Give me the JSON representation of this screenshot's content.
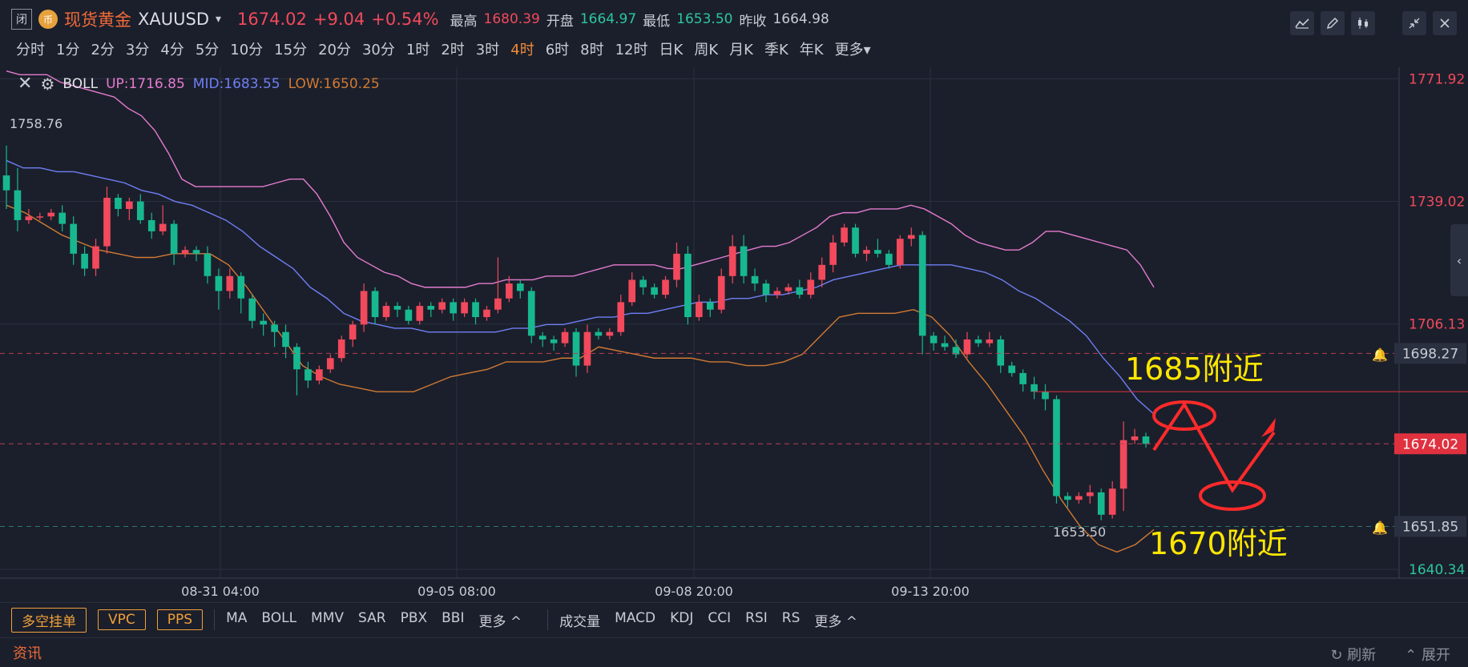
{
  "header": {
    "close_label": "闭",
    "coin_label": "币",
    "title": "现货黄金",
    "symbol": "XAUUSD",
    "dropdown_caret": "▾",
    "last_price": "1674.02",
    "change": "+9.04",
    "change_pct": "+0.54%",
    "high_label": "最高",
    "high_value": "1680.39",
    "open_label": "开盘",
    "open_value": "1664.97",
    "low_label": "最低",
    "low_value": "1653.50",
    "prev_close_label": "昨收",
    "prev_close_value": "1664.98"
  },
  "periods": [
    {
      "label": "分时",
      "active": false
    },
    {
      "label": "1分",
      "active": false
    },
    {
      "label": "2分",
      "active": false
    },
    {
      "label": "3分",
      "active": false
    },
    {
      "label": "4分",
      "active": false
    },
    {
      "label": "5分",
      "active": false
    },
    {
      "label": "10分",
      "active": false
    },
    {
      "label": "15分",
      "active": false
    },
    {
      "label": "20分",
      "active": false
    },
    {
      "label": "30分",
      "active": false
    },
    {
      "label": "1时",
      "active": false
    },
    {
      "label": "2时",
      "active": false
    },
    {
      "label": "3时",
      "active": false
    },
    {
      "label": "4时",
      "active": true
    },
    {
      "label": "6时",
      "active": false
    },
    {
      "label": "8时",
      "active": false
    },
    {
      "label": "12时",
      "active": false
    },
    {
      "label": "日K",
      "active": false
    },
    {
      "label": "周K",
      "active": false
    },
    {
      "label": "月K",
      "active": false
    },
    {
      "label": "季K",
      "active": false
    },
    {
      "label": "年K",
      "active": false
    },
    {
      "label": "更多▾",
      "active": false
    }
  ],
  "toolbar": {
    "icons": [
      "line-chart-icon",
      "pencil-icon",
      "candlestick-icon",
      "collapse-icon",
      "close-icon"
    ]
  },
  "boll": {
    "name": "BOLL",
    "up": "UP:1716.85",
    "mid": "MID:1683.55",
    "low": "LOW:1650.25",
    "colors": {
      "up": "#e57bd0",
      "mid": "#6f7ff5",
      "low": "#d17a33"
    }
  },
  "chart_data": {
    "type": "candlestick",
    "y_axis_ticks": [
      "1771.92",
      "1739.02",
      "1706.13",
      "1640.34"
    ],
    "price_tags": [
      "1698.27",
      "1674.02",
      "1651.85"
    ],
    "x_axis_ticks": [
      "08-31 04:00",
      "09-05 08:00",
      "09-08 20:00",
      "09-13 20:00"
    ],
    "ylim": [
      1638,
      1775
    ],
    "high_marker": "1758.76",
    "low_marker": "1653.50",
    "candles": [
      [
        1746,
        1742,
        1754,
        1737
      ],
      [
        1742,
        1734,
        1748,
        1731
      ],
      [
        1734,
        1735,
        1737,
        1733
      ],
      [
        1735,
        1735,
        1736,
        1734
      ],
      [
        1735,
        1736,
        1737,
        1734
      ],
      [
        1736,
        1733,
        1738,
        1731
      ],
      [
        1733,
        1725,
        1735,
        1722
      ],
      [
        1725,
        1721,
        1727,
        1719
      ],
      [
        1721,
        1727,
        1729,
        1719
      ],
      [
        1727,
        1740,
        1743,
        1725
      ],
      [
        1740,
        1737,
        1741,
        1735
      ],
      [
        1737,
        1739,
        1740,
        1734
      ],
      [
        1739,
        1734,
        1741,
        1733
      ],
      [
        1734,
        1731,
        1736,
        1729
      ],
      [
        1731,
        1733,
        1738,
        1730
      ],
      [
        1733,
        1725,
        1734,
        1722
      ],
      [
        1725,
        1726,
        1727,
        1724
      ],
      [
        1726,
        1725,
        1727,
        1723
      ],
      [
        1725,
        1719,
        1727,
        1717
      ],
      [
        1719,
        1715,
        1721,
        1710
      ],
      [
        1715,
        1719,
        1721,
        1713
      ],
      [
        1719,
        1713,
        1720,
        1709
      ],
      [
        1713,
        1707,
        1714,
        1705
      ],
      [
        1707,
        1706,
        1709,
        1703
      ],
      [
        1706,
        1704,
        1707,
        1700
      ],
      [
        1704,
        1700,
        1706,
        1697
      ],
      [
        1700,
        1694,
        1701,
        1687
      ],
      [
        1694,
        1691,
        1696,
        1689
      ],
      [
        1691,
        1694,
        1695,
        1690
      ],
      [
        1694,
        1697,
        1698,
        1693
      ],
      [
        1697,
        1702,
        1703,
        1696
      ],
      [
        1702,
        1706,
        1707,
        1700
      ],
      [
        1706,
        1715,
        1717,
        1704
      ],
      [
        1715,
        1708,
        1716,
        1706
      ],
      [
        1708,
        1711,
        1712,
        1707
      ],
      [
        1711,
        1710,
        1712,
        1708
      ],
      [
        1710,
        1707,
        1711,
        1706
      ],
      [
        1707,
        1711,
        1712,
        1706
      ],
      [
        1711,
        1710,
        1712,
        1708
      ],
      [
        1710,
        1712,
        1713,
        1709
      ],
      [
        1712,
        1709,
        1713,
        1707
      ],
      [
        1709,
        1712,
        1713,
        1708
      ],
      [
        1712,
        1708,
        1713,
        1706
      ],
      [
        1708,
        1710,
        1711,
        1707
      ],
      [
        1710,
        1713,
        1724,
        1709
      ],
      [
        1713,
        1717,
        1719,
        1712
      ],
      [
        1717,
        1715,
        1718,
        1713
      ],
      [
        1715,
        1703,
        1716,
        1701
      ],
      [
        1703,
        1702,
        1704,
        1700
      ],
      [
        1702,
        1701,
        1703,
        1699
      ],
      [
        1701,
        1704,
        1705,
        1700
      ],
      [
        1704,
        1695,
        1705,
        1692
      ],
      [
        1695,
        1704,
        1706,
        1693
      ],
      [
        1704,
        1703,
        1705,
        1702
      ],
      [
        1703,
        1704,
        1705,
        1702
      ],
      [
        1704,
        1712,
        1714,
        1703
      ],
      [
        1712,
        1718,
        1720,
        1711
      ],
      [
        1718,
        1716,
        1719,
        1714
      ],
      [
        1716,
        1714,
        1717,
        1713
      ],
      [
        1714,
        1718,
        1719,
        1713
      ],
      [
        1718,
        1725,
        1728,
        1716
      ],
      [
        1725,
        1708,
        1727,
        1706
      ],
      [
        1708,
        1712,
        1714,
        1707
      ],
      [
        1712,
        1710,
        1713,
        1708
      ],
      [
        1710,
        1719,
        1721,
        1709
      ],
      [
        1719,
        1727,
        1730,
        1717
      ],
      [
        1727,
        1719,
        1730,
        1717
      ],
      [
        1719,
        1717,
        1721,
        1715
      ],
      [
        1717,
        1714,
        1718,
        1712
      ],
      [
        1714,
        1715,
        1716,
        1713
      ],
      [
        1715,
        1716,
        1717,
        1714
      ],
      [
        1716,
        1714,
        1718,
        1713
      ],
      [
        1714,
        1718,
        1720,
        1713
      ],
      [
        1718,
        1722,
        1724,
        1716
      ],
      [
        1722,
        1728,
        1730,
        1720
      ],
      [
        1728,
        1732,
        1733,
        1727
      ],
      [
        1732,
        1725,
        1733,
        1724
      ],
      [
        1725,
        1726,
        1727,
        1723
      ],
      [
        1726,
        1725,
        1729,
        1724
      ],
      [
        1725,
        1722,
        1726,
        1721
      ],
      [
        1722,
        1729,
        1730,
        1721
      ],
      [
        1729,
        1730,
        1732,
        1727
      ],
      [
        1730,
        1703,
        1731,
        1698
      ],
      [
        1703,
        1701,
        1704,
        1699
      ],
      [
        1701,
        1700,
        1703,
        1699
      ],
      [
        1700,
        1698,
        1702,
        1697
      ],
      [
        1698,
        1702,
        1704,
        1697
      ],
      [
        1702,
        1701,
        1703,
        1700
      ],
      [
        1701,
        1702,
        1704,
        1700
      ],
      [
        1702,
        1695,
        1703,
        1693
      ],
      [
        1695,
        1693,
        1696,
        1692
      ],
      [
        1693,
        1690,
        1694,
        1688
      ],
      [
        1690,
        1688,
        1692,
        1686
      ],
      [
        1688,
        1686,
        1690,
        1683
      ],
      [
        1686,
        1660,
        1687,
        1658
      ],
      [
        1660,
        1659,
        1661,
        1657
      ],
      [
        1659,
        1660,
        1661,
        1658
      ],
      [
        1660,
        1661,
        1663,
        1658
      ],
      [
        1661,
        1655,
        1662,
        1653.5
      ],
      [
        1655,
        1662,
        1664,
        1654
      ],
      [
        1662,
        1675,
        1680,
        1656
      ],
      [
        1675,
        1676,
        1678,
        1674
      ],
      [
        1676,
        1674,
        1677,
        1673
      ]
    ],
    "boll_up": [
      1774,
      1773,
      1773,
      1773,
      1771,
      1770,
      1769,
      1768,
      1767,
      1764,
      1762,
      1758,
      1752,
      1745,
      1743,
      1743,
      1743,
      1743,
      1743,
      1743,
      1744,
      1745,
      1745,
      1741,
      1735,
      1728,
      1724,
      1722,
      1720,
      1719,
      1717,
      1716,
      1716,
      1716,
      1716,
      1717,
      1717,
      1718,
      1718,
      1718,
      1719,
      1719,
      1719,
      1720,
      1721,
      1722,
      1722,
      1722,
      1722,
      1721,
      1721,
      1722,
      1723,
      1724,
      1725,
      1726,
      1727,
      1727,
      1728,
      1730,
      1732,
      1735,
      1736,
      1736,
      1737,
      1737,
      1737,
      1738,
      1737,
      1735,
      1733,
      1730,
      1728,
      1727,
      1726,
      1726,
      1728,
      1731,
      1731,
      1730,
      1729,
      1728,
      1727,
      1726,
      1722,
      1716
    ],
    "boll_mid": [
      1750,
      1748,
      1748,
      1747,
      1747,
      1746,
      1745,
      1744,
      1742,
      1741,
      1739,
      1738,
      1736,
      1734,
      1731,
      1727,
      1724,
      1721,
      1716,
      1713,
      1709,
      1707,
      1706,
      1705,
      1705,
      1704,
      1704,
      1704,
      1704,
      1704,
      1705,
      1705,
      1706,
      1706,
      1707,
      1708,
      1708,
      1709,
      1709,
      1710,
      1711,
      1712,
      1712,
      1713,
      1713,
      1714,
      1714,
      1715,
      1716,
      1718,
      1719,
      1720,
      1721,
      1722,
      1722,
      1722,
      1722,
      1721,
      1720,
      1718,
      1715,
      1713,
      1710,
      1707,
      1703,
      1697,
      1692,
      1686,
      1682
    ],
    "boll_low": [
      1738,
      1736,
      1733,
      1730,
      1728,
      1726,
      1725,
      1724,
      1724,
      1725,
      1725,
      1725,
      1722,
      1716,
      1709,
      1702,
      1695,
      1692,
      1690,
      1689,
      1688,
      1688,
      1688,
      1690,
      1692,
      1693,
      1694,
      1696,
      1696,
      1696,
      1697,
      1697,
      1700,
      1699,
      1698,
      1697,
      1697,
      1697,
      1696,
      1696,
      1695,
      1695,
      1696,
      1698,
      1703,
      1708,
      1709,
      1709,
      1709,
      1710,
      1708,
      1703,
      1696,
      1690,
      1683,
      1676,
      1667,
      1659,
      1652,
      1647,
      1645,
      1647,
      1651
    ],
    "annotations": [
      "1685附近",
      "1670附近"
    ]
  },
  "indicators": {
    "buttons": [
      "多空挂单",
      "VPC",
      "PPS"
    ],
    "main": [
      "MA",
      "BOLL",
      "MMV",
      "SAR",
      "PBX",
      "BBI",
      "更多 ^"
    ],
    "sub": [
      "成交量",
      "MACD",
      "KDJ",
      "CCI",
      "RSI",
      "RS",
      "更多 ^"
    ]
  },
  "bottom": {
    "news": "资讯",
    "refresh": "刷新",
    "expand": "展开"
  }
}
